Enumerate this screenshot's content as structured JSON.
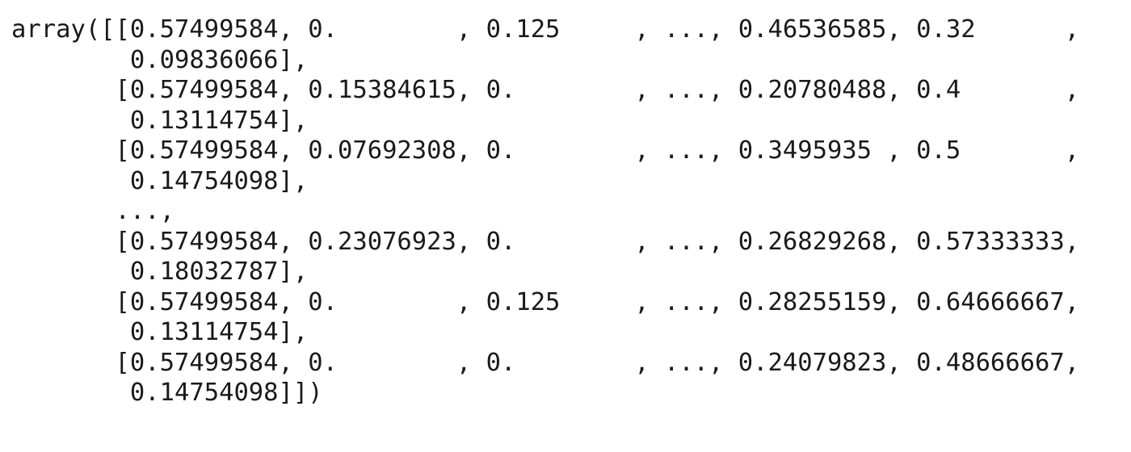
{
  "output": {
    "lines": [
      "array([[0.57499584, 0.        , 0.125     , ..., 0.46536585, 0.32      ,",
      "        0.09836066],",
      "       [0.57499584, 0.15384615, 0.        , ..., 0.20780488, 0.4       ,",
      "        0.13114754],",
      "       [0.57499584, 0.07692308, 0.        , ..., 0.3495935 , 0.5       ,",
      "        0.14754098],",
      "       ...,",
      "       [0.57499584, 0.23076923, 0.        , ..., 0.26829268, 0.57333333,",
      "        0.18032787],",
      "       [0.57499584, 0.        , 0.125     , ..., 0.28255159, 0.64666667,",
      "        0.13114754],",
      "       [0.57499584, 0.        , 0.        , ..., 0.24079823, 0.48666667,",
      "        0.14754098]])"
    ]
  }
}
